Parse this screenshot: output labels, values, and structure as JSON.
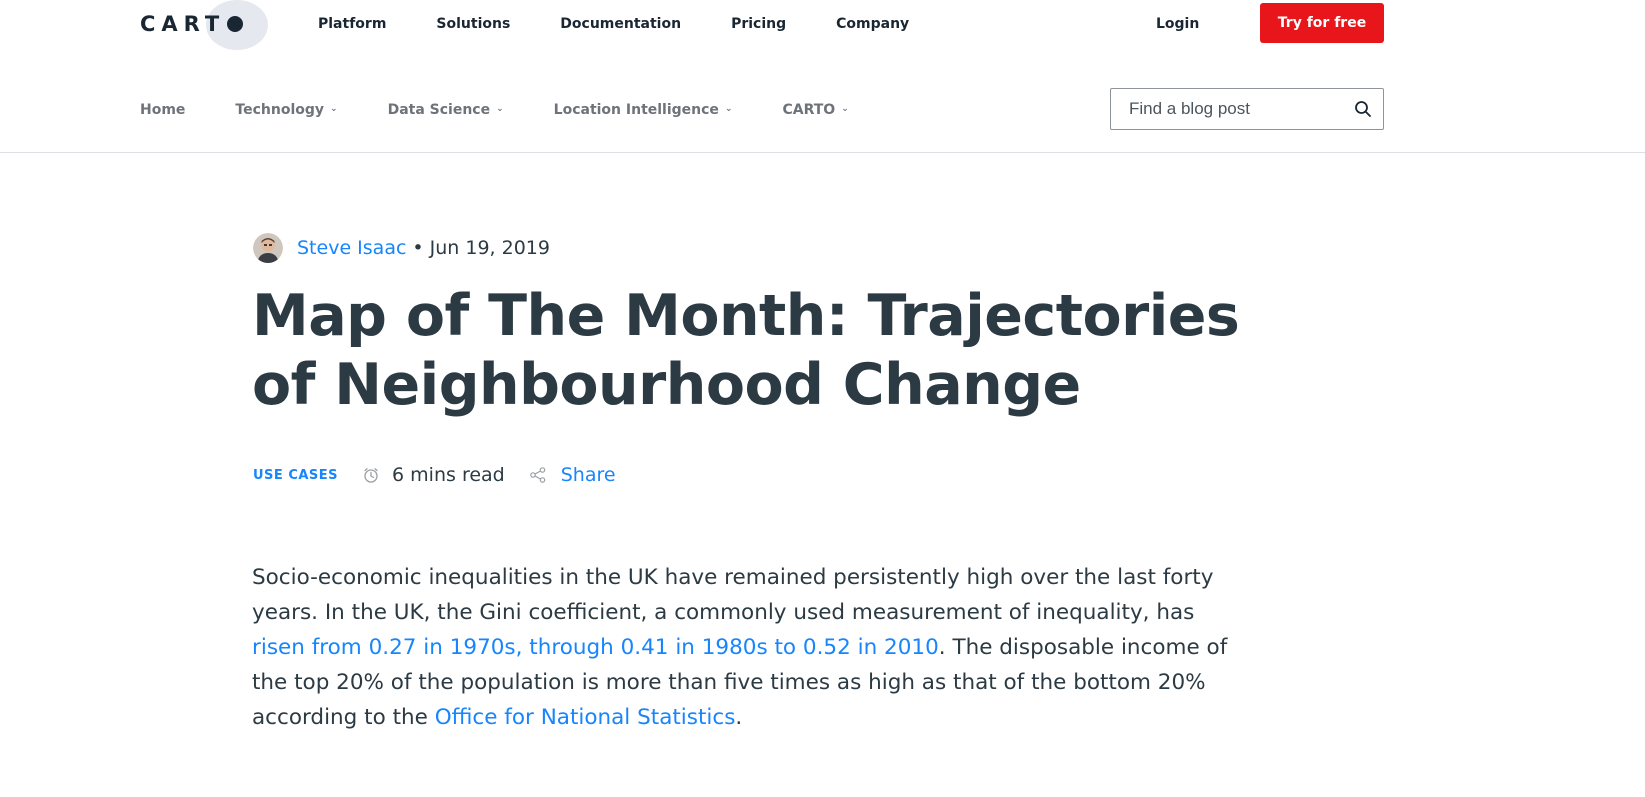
{
  "header": {
    "logo_text": "CARTO",
    "nav": [
      {
        "label": "Platform"
      },
      {
        "label": "Solutions"
      },
      {
        "label": "Documentation"
      },
      {
        "label": "Pricing"
      },
      {
        "label": "Company"
      }
    ],
    "login_label": "Login",
    "cta_label": "Try for free"
  },
  "blog_nav": {
    "items": [
      {
        "label": "Home",
        "has_dropdown": false
      },
      {
        "label": "Technology",
        "has_dropdown": true
      },
      {
        "label": "Data Science",
        "has_dropdown": true
      },
      {
        "label": "Location Intelligence",
        "has_dropdown": true
      },
      {
        "label": "CARTO",
        "has_dropdown": true
      }
    ],
    "search_placeholder": "Find a blog post"
  },
  "article": {
    "author": "Steve Isaac",
    "separator": "•",
    "date": "Jun 19, 2019",
    "title": "Map of The Month: Trajectories of Neighbourhood Change",
    "category": "USE CASES",
    "read_time": "6 mins read",
    "share_label": "Share",
    "body": {
      "p1_part1": "Socio-economic inequalities in the UK have remained persistently high over the last forty years. In the UK, the Gini coefficient, a commonly used measurement of inequality, has ",
      "p1_link1": "risen from 0.27 in 1970s, through 0.41 in 1980s to 0.52 in 2010",
      "p1_part2": ". The disposable income of the top 20% of the population is more than five times as high as that of the bottom 20% according to the ",
      "p1_link2": "Office for National Statistics",
      "p1_part3": "."
    }
  },
  "colors": {
    "accent_blue": "#1785fb",
    "cta_red": "#e8151a",
    "text_dark": "#2c3a43",
    "nav_gray": "#6d737a"
  },
  "icons": {
    "search": "search-icon",
    "clock": "clock-icon",
    "share": "share-icon",
    "chevron": "chevron-down-icon"
  }
}
